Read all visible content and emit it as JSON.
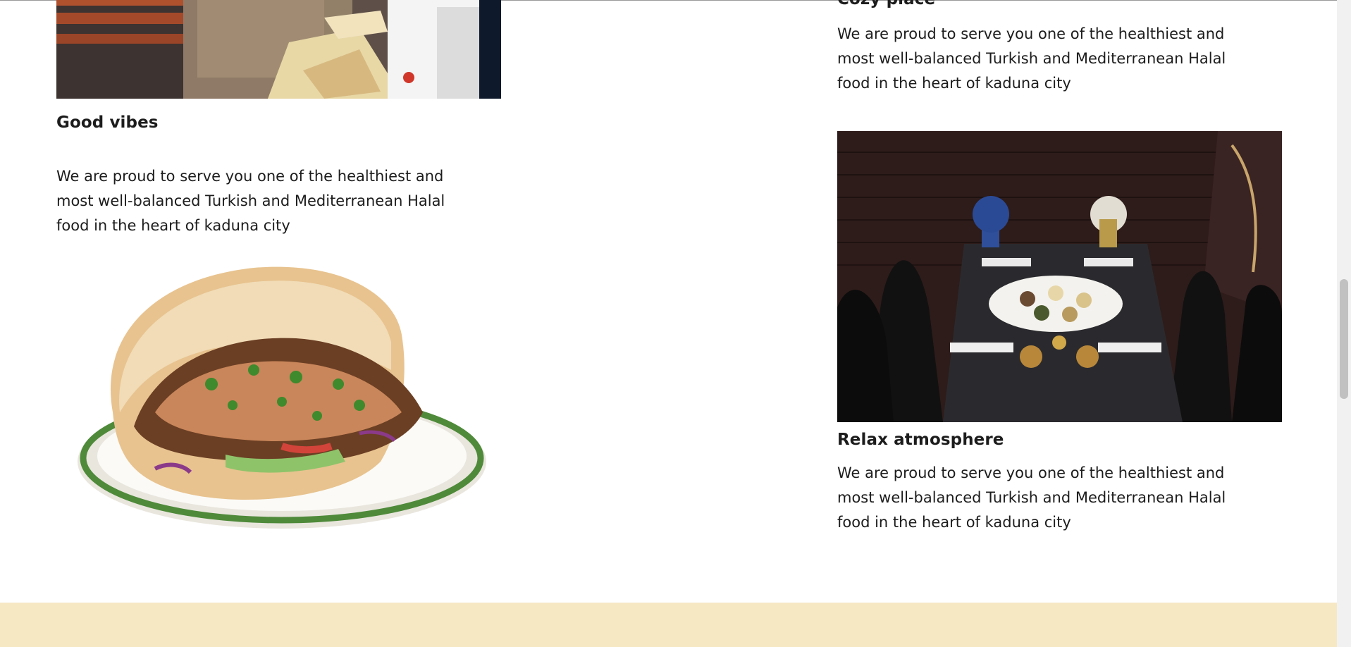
{
  "sections": {
    "cozy_place": {
      "heading": "Cozy place",
      "text": "We are proud to serve you one of the healthiest and most well-balanced Turkish and Mediterranean Halal food in the heart of kaduna city"
    },
    "good_vibes": {
      "heading": "Good vibes",
      "text": "We are proud to serve you one of the healthiest and most well-balanced Turkish and Mediterranean Halal food in the heart of kaduna city"
    },
    "relax_atmosphere": {
      "heading": "Relax atmosphere",
      "text": "We are proud to serve you one of the healthiest and most well-balanced Turkish and Mediterranean Halal food in the heart of kaduna city"
    }
  },
  "colors": {
    "background": "#ffffff",
    "text": "#1c1c1c",
    "footer_band": "#f7e8c4"
  }
}
